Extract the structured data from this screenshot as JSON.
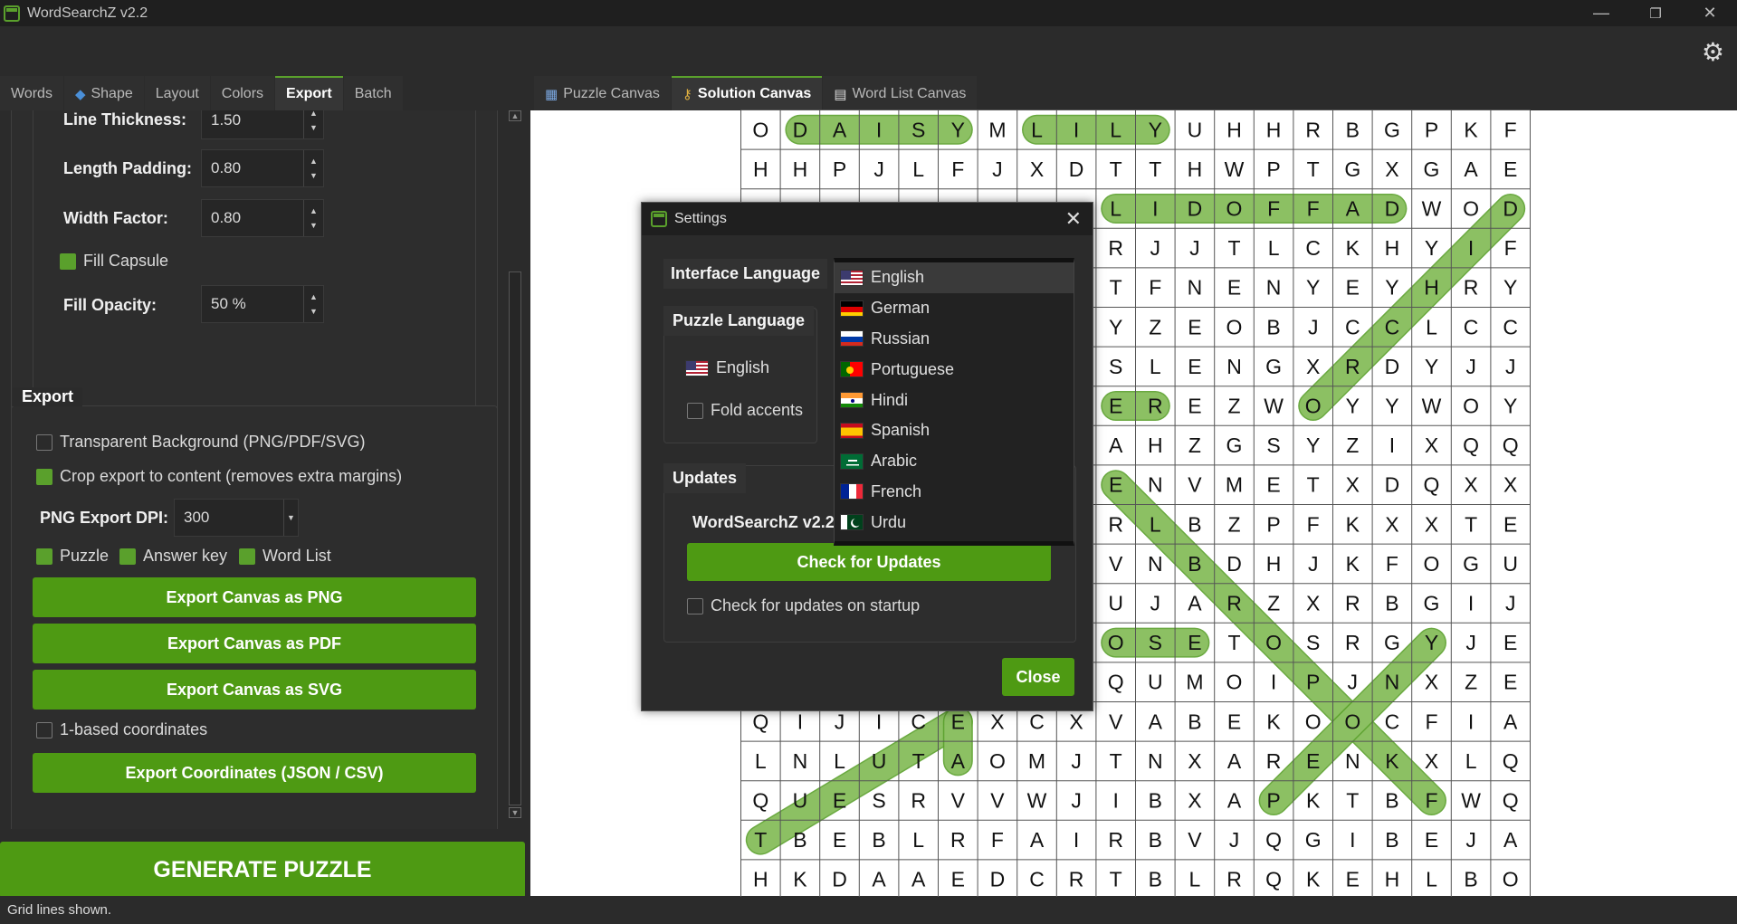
{
  "window": {
    "title": "WordSearchZ v2.2",
    "minimize": "—",
    "restore": "❐",
    "close": "✕"
  },
  "left_tabs": [
    "Words",
    "Shape",
    "Layout",
    "Colors",
    "Export",
    "Batch"
  ],
  "left_tabs_active": "Export",
  "right_tabs": [
    "Puzzle Canvas",
    "Solution Canvas",
    "Word List Canvas"
  ],
  "right_tabs_active": "Solution Canvas",
  "settings_panel": {
    "line_thickness_label": "Line Thickness:",
    "line_thickness": "1.50",
    "length_padding_label": "Length Padding:",
    "length_padding": "0.80",
    "width_factor_label": "Width Factor:",
    "width_factor": "0.80",
    "fill_capsule_label": "Fill Capsule",
    "fill_opacity_label": "Fill Opacity:",
    "fill_opacity": "50 %"
  },
  "export": {
    "section_title": "Export",
    "transparent_bg": "Transparent Background (PNG/PDF/SVG)",
    "crop_export": "Crop export to content (removes extra margins)",
    "dpi_label": "PNG Export DPI:",
    "dpi_value": "300",
    "puzzle": "Puzzle",
    "answer_key": "Answer key",
    "word_list": "Word List",
    "btn_png": "Export Canvas as PNG",
    "btn_pdf": "Export Canvas as PDF",
    "btn_svg": "Export Canvas as SVG",
    "one_based": "1-based coordinates",
    "btn_coords": "Export Coordinates (JSON / CSV)"
  },
  "generate_button": "GENERATE PUZZLE",
  "status_text": "Grid lines shown.",
  "grid": {
    "rows": [
      "ODAISYMLILYUHHRBGPKF",
      "HHPJLFJXDTTHWPTGXGAE",
      "",
      "",
      "",
      "",
      "",
      "",
      "",
      "",
      "",
      "",
      "",
      "",
      "",
      "QIJICEXCXVABEKOOCFIA",
      "LNLUTAOMJTNXAREN KXLQ",
      "QUESRVVWJIBXAPKTBFWQ",
      "TBEBLRFAIRBVJQGIBEJA",
      "HKDAAEDCRTBLRQKEHLBO"
    ],
    "right_rows": [
      "",
      "",
      "LIDOFFADWOD",
      "RJJTLCKHYIF",
      "TFNENYEYHRY",
      "YZEOBJCCLCC",
      "SLENGXRDYJJ",
      "EREZWOYYWOY",
      "AHZGSYZIXQQ",
      "ENVMETXDQXX",
      "RLBZPFKXXTE",
      "VNBDHJKFOGU",
      "UJARZXRBGIJ",
      "OSETOSRGYJE",
      "QUMOIPJNXZE"
    ]
  },
  "settings_dialog": {
    "title": "Settings",
    "interface_language_label": "Interface Language",
    "puzzle_language_label": "Puzzle Language",
    "puzzle_language_value": "English",
    "fold_accents": "Fold accents",
    "updates_label": "Updates",
    "version": "WordSearchZ v2.2",
    "check_updates_btn": "Check for Updates",
    "check_on_startup": "Check for updates on startup",
    "close_btn": "Close",
    "languages": [
      "English",
      "German",
      "Russian",
      "Portuguese",
      "Hindi",
      "Spanish",
      "Arabic",
      "French",
      "Urdu"
    ]
  },
  "colors": {
    "accent": "#4e9a13",
    "highlight": "#8cc063"
  }
}
